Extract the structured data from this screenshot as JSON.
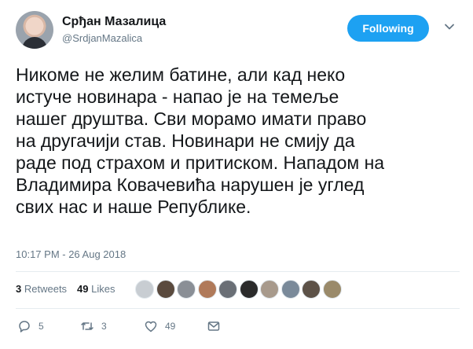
{
  "author": {
    "name": "Срђан Мазалица",
    "handle": "@SrdjanMazalica"
  },
  "follow_button": {
    "label": "Following"
  },
  "tweet": {
    "lines": [
      "Никоме не желим батине, али кад неко",
      "истуче новинара - напао је на темеље",
      "нашег друштва. Сви морамо имати право",
      "на другачији став. Новинари не смију да",
      "раде под страхом и притиском. Нападом на",
      "Владимира Ковачевића нарушен је углед",
      "свих нас и наше Републике."
    ],
    "timestamp": "10:17 PM - 26 Aug 2018"
  },
  "stats": {
    "retweets_count": "3",
    "retweets_label": "Retweets",
    "likes_count": "49",
    "likes_label": "Likes"
  },
  "likers": [
    {
      "color": "#c8cdd2"
    },
    {
      "color": "#5a4a3e"
    },
    {
      "color": "#8a8f96"
    },
    {
      "color": "#b07a5a"
    },
    {
      "color": "#6a6f76"
    },
    {
      "color": "#2b2b2b"
    },
    {
      "color": "#a89a8c"
    },
    {
      "color": "#7a8a9a"
    },
    {
      "color": "#5d5248"
    },
    {
      "color": "#9a8a6a"
    }
  ],
  "actions": {
    "reply_count": "5",
    "retweet_count": "3",
    "like_count": "49"
  },
  "colors": {
    "accent": "#1da1f2",
    "secondary_text": "#657786",
    "divider": "#e6ecf0"
  }
}
